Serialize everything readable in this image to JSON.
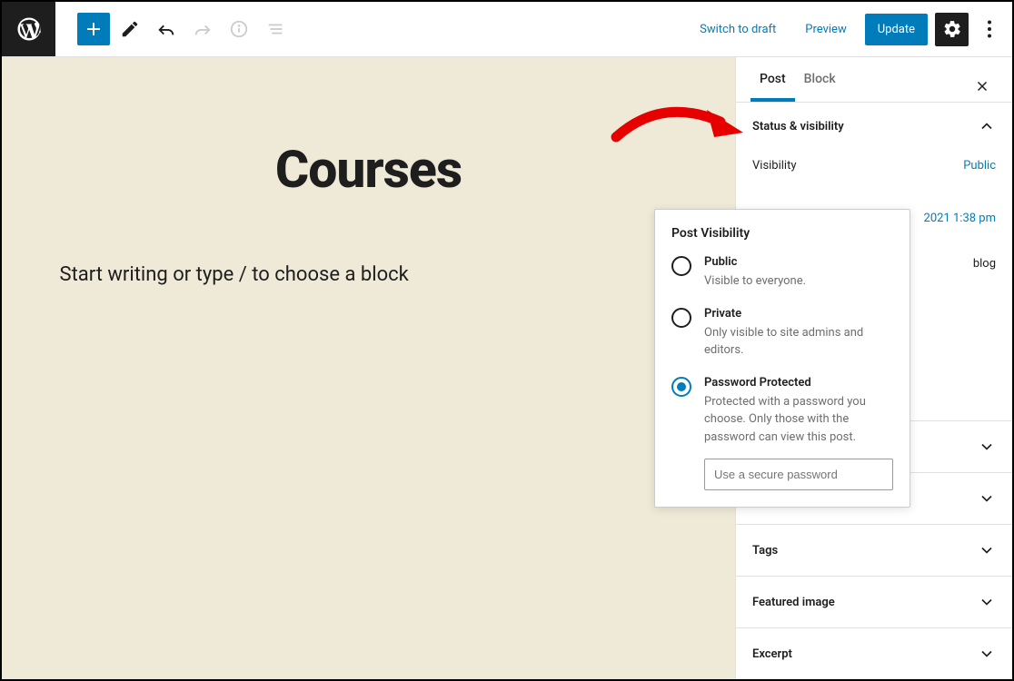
{
  "toolbar": {
    "switch_draft": "Switch to draft",
    "preview": "Preview",
    "update": "Update"
  },
  "canvas": {
    "title": "Courses",
    "placeholder": "Start writing or type / to choose a block"
  },
  "sidebar": {
    "tabs": {
      "post": "Post",
      "block": "Block"
    },
    "status_panel": {
      "title": "Status & visibility",
      "visibility_label": "Visibility",
      "visibility_value": "Public"
    },
    "publish_peek": "2021 1:38 pm",
    "blog_peek": "blog",
    "collapsed": {
      "panel1_blank": "",
      "panel2_blank": "",
      "tags": "Tags",
      "featured": "Featured image",
      "excerpt": "Excerpt"
    }
  },
  "popover": {
    "title": "Post Visibility",
    "options": [
      {
        "label": "Public",
        "desc": "Visible to everyone."
      },
      {
        "label": "Private",
        "desc": "Only visible to site admins and editors."
      },
      {
        "label": "Password Protected",
        "desc": "Protected with a password you choose. Only those with the password can view this post."
      }
    ],
    "password_placeholder": "Use a secure password"
  }
}
